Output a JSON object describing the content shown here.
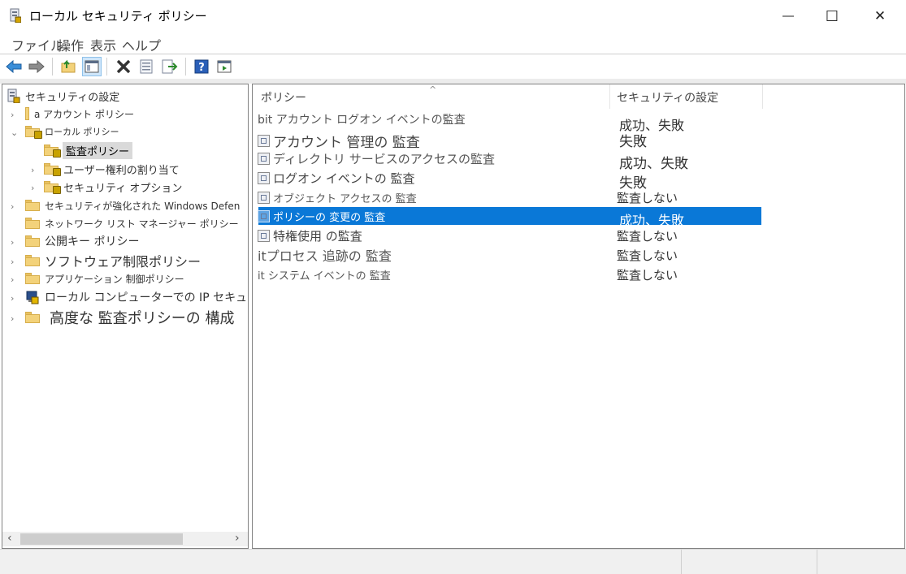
{
  "window": {
    "title": "ローカル セキュリティ ポリシー",
    "controls": {
      "minimize": "―",
      "maximize": "☐",
      "close": "✕"
    }
  },
  "menu": [
    "ファイル",
    "操作",
    "表示",
    "ヘルプ"
  ],
  "toolbar": [
    "back-arrow-icon",
    "forward-arrow-icon",
    "up-folder-icon",
    "show-tree-icon",
    "delete-icon",
    "properties-icon",
    "export-list-icon",
    "help-icon",
    "show-action-pane-icon"
  ],
  "tree": {
    "root": "セキュリティの設定",
    "items": [
      {
        "label": "a アカウント ポリシー",
        "level": 1,
        "expander": "›"
      },
      {
        "label": "ローカル ポリシー",
        "level": 1,
        "expander": "⌄"
      },
      {
        "label": "監査ポリシー",
        "level": 2,
        "expander": ""
      },
      {
        "label": "ユーザー権利の割り当て",
        "level": 2,
        "expander": "›"
      },
      {
        "label": "セキュリティ オプション",
        "level": 2,
        "expander": "›"
      },
      {
        "label": "セキュリティが強化された Windows Defen",
        "level": 1,
        "expander": "›"
      },
      {
        "label": "ネットワーク リスト マネージャー ポリシー",
        "level": 1,
        "expander": ""
      },
      {
        "label": "公開キー ポリシー",
        "level": 1,
        "expander": "›"
      },
      {
        "label": "ソフトウェア制限ポリシー",
        "level": 1,
        "expander": "›"
      },
      {
        "label": "アプリケーション 制御ポリシー",
        "level": 1,
        "expander": "›"
      },
      {
        "label": "ローカル コンピューターでの IP セキュリティ ポリシー",
        "level": 1,
        "expander": "›"
      },
      {
        "label": "高度な 監査ポリシーの 構成",
        "level": 1,
        "expander": "›"
      }
    ]
  },
  "list": {
    "sort_indicator": "^",
    "columns": [
      "ポリシー",
      "セキュリティの設定"
    ],
    "rows": [
      {
        "policy": "bit アカウント ログオン イベントの監査",
        "setting": "成功、失敗"
      },
      {
        "policy": "アカウント 管理の 監査",
        "setting": "失敗"
      },
      {
        "policy": "ディレクトリ サービスのアクセスの監査",
        "setting": "成功、失敗"
      },
      {
        "policy": "ログオン イベントの 監査",
        "setting": "失敗"
      },
      {
        "policy": "オブジェクト アクセスの 監査",
        "setting": "監査しない"
      },
      {
        "policy": "ポリシーの 変更の 監査",
        "setting": "成功、失敗"
      },
      {
        "policy": "特権使用 の監査",
        "setting": "監査しない"
      },
      {
        "policy": "itプロセス 追跡の 監査",
        "setting": "監査しない"
      },
      {
        "policy": "it システム イベントの 監査",
        "setting": "監査しない"
      }
    ]
  },
  "scroll": {
    "left": "‹",
    "right": "›"
  },
  "colors": {
    "selection": "#0a78d7",
    "folder": "#f3d27a"
  }
}
